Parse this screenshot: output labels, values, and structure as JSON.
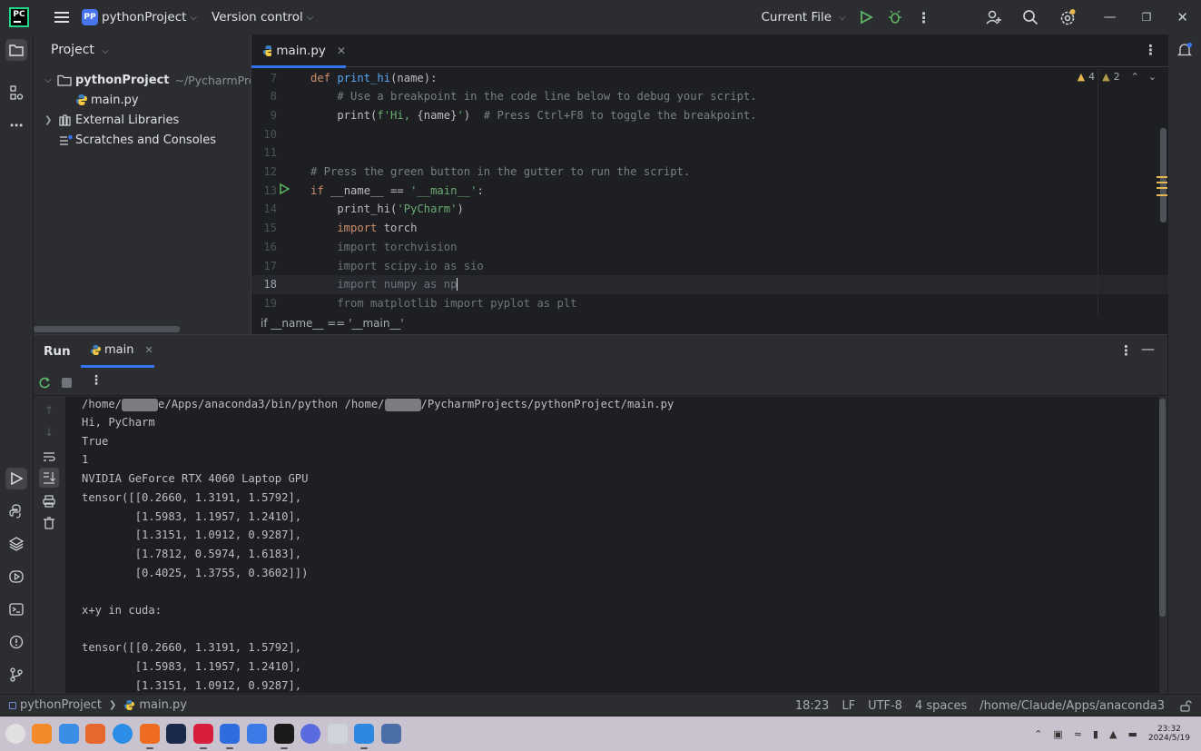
{
  "titlebar": {
    "logo": "PC",
    "project_badge": "PP",
    "project_name": "pythonProject",
    "version_control": "Version control",
    "run_config": "Current File",
    "icons": [
      "hamburger-icon",
      "run-icon",
      "debug-icon",
      "more-icon",
      "add-user-icon",
      "search-icon",
      "settings-icon",
      "minimize-icon",
      "restore-icon",
      "close-icon"
    ]
  },
  "project_panel": {
    "title": "Project",
    "tree": [
      {
        "label": "pythonProject",
        "hint": "~/PycharmProjec",
        "type": "folder",
        "expanded": true
      },
      {
        "label": "main.py",
        "type": "python-file"
      },
      {
        "label": "External Libraries",
        "type": "library",
        "expanded": false
      },
      {
        "label": "Scratches and Consoles",
        "type": "scratches"
      }
    ]
  },
  "editor": {
    "tab": "main.py",
    "inspections": {
      "warnings": "4",
      "weak_warnings": "2"
    },
    "breadcrumb": "if __name__ == '__main__'",
    "lines": [
      {
        "num": "7",
        "tokens": [
          [
            "kw",
            "def "
          ],
          [
            "fn",
            "print_hi"
          ],
          [
            "txt",
            "(name):"
          ]
        ]
      },
      {
        "num": "8",
        "tokens": [
          [
            "cm",
            "    # Use a breakpoint in the code line below to debug your script."
          ]
        ]
      },
      {
        "num": "9",
        "tokens": [
          [
            "txt",
            "    print("
          ],
          [
            "str",
            "f'Hi, "
          ],
          [
            "txt",
            "{name}"
          ],
          [
            "str",
            "'"
          ],
          [
            "txt",
            ")  "
          ],
          [
            "cm",
            "# Press Ctrl+F8 to toggle the breakpoint."
          ]
        ]
      },
      {
        "num": "10",
        "tokens": []
      },
      {
        "num": "11",
        "tokens": []
      },
      {
        "num": "12",
        "tokens": [
          [
            "cm",
            "# Press the green button in the gutter to run the script."
          ]
        ]
      },
      {
        "num": "13",
        "tokens": [
          [
            "kw",
            "if "
          ],
          [
            "txt",
            "__name__ == "
          ],
          [
            "str",
            "'__main__'"
          ],
          [
            "txt",
            ":"
          ]
        ]
      },
      {
        "num": "14",
        "tokens": [
          [
            "txt",
            "    print_hi("
          ],
          [
            "str",
            "'PyCharm'"
          ],
          [
            "txt",
            ")"
          ]
        ]
      },
      {
        "num": "15",
        "tokens": [
          [
            "kw",
            "    import "
          ],
          [
            "txt",
            "torch"
          ]
        ]
      },
      {
        "num": "16",
        "tokens": [
          [
            "dim",
            "    import torchvision"
          ]
        ]
      },
      {
        "num": "17",
        "tokens": [
          [
            "dim",
            "    import scipy.io as sio"
          ]
        ]
      },
      {
        "num": "18",
        "tokens": [
          [
            "dim",
            "    import numpy as np"
          ]
        ]
      },
      {
        "num": "19",
        "tokens": [
          [
            "dim",
            "    from matplotlib import pyplot as plt"
          ]
        ]
      }
    ],
    "current_line": "18"
  },
  "run_panel": {
    "title": "Run",
    "tab": "main",
    "console": {
      "command_prefix": "/home/",
      "command_mid": "e/Apps/anaconda3/bin/python /home/",
      "command_suffix": "/PycharmProjects/pythonProject/main.py",
      "lines": [
        "Hi, PyCharm",
        "True",
        "1",
        "NVIDIA GeForce RTX 4060 Laptop GPU",
        "tensor([[0.2660, 1.3191, 1.5792],",
        "        [1.5983, 1.1957, 1.2410],",
        "        [1.3151, 1.0912, 0.9287],",
        "        [1.7812, 0.5974, 1.6183],",
        "        [0.4025, 1.3755, 0.3602]])",
        "",
        "x+y in cuda:",
        "",
        "tensor([[0.2660, 1.3191, 1.5792],",
        "        [1.5983, 1.1957, 1.2410],",
        "        [1.3151, 1.0912, 0.9287],"
      ]
    }
  },
  "statusbar": {
    "project": "pythonProject",
    "file": "main.py",
    "position": "18:23",
    "line_sep": "LF",
    "encoding": "UTF-8",
    "indent": "4 spaces",
    "interpreter": "/home/Claude/Apps/anaconda3"
  },
  "taskbar": {
    "time": "23:32",
    "date": "2024/5/19",
    "apps": [
      "launcher",
      "multitask",
      "files",
      "app-store",
      "browser",
      "firefox",
      "terminal-a",
      "terminal-b",
      "chat",
      "windows-app",
      "pycharm",
      "settings",
      "manager",
      "notes",
      "remote"
    ]
  },
  "colors": {
    "background": "#1e1f22",
    "panel": "#2b2d30",
    "accent": "#3574f0",
    "run_green": "#5fb865",
    "warning": "#e6b450"
  }
}
